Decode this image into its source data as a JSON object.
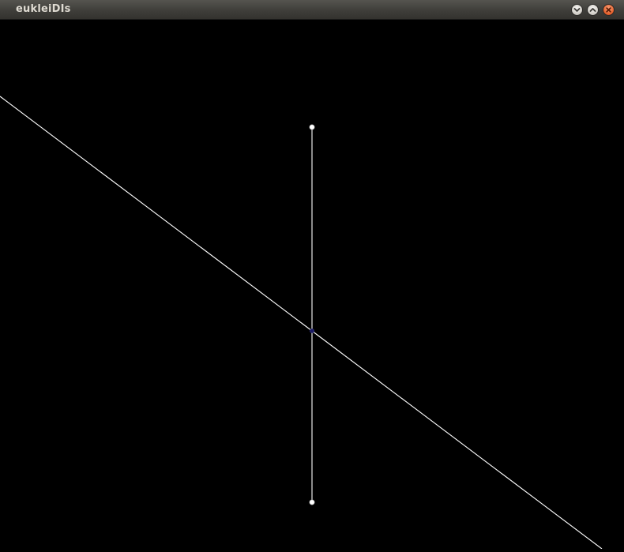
{
  "window": {
    "title": "eukleiDIs"
  },
  "controls": {
    "minimize_icon": "chevron-down-icon",
    "maximize_icon": "chevron-up-icon",
    "close_icon": "close-icon"
  },
  "colors": {
    "canvas_background": "#000000",
    "line": "#ffffff",
    "point": "#ffffff",
    "intersection_point": "#1a1a66",
    "close_button": "#e8632e"
  }
}
